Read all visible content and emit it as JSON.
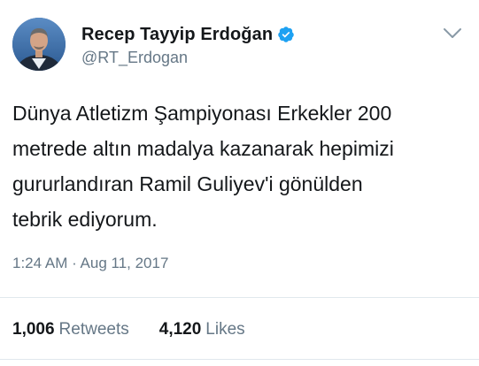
{
  "tweet": {
    "author": {
      "display_name": "Recep Tayyip Erdoğan",
      "handle": "@RT_Erdogan",
      "verified": true,
      "avatar_icon": "profile-photo"
    },
    "text": "Dünya Atletizm Şampiyonası Erkekler 200\nmetrede altın madalya kazanarak hepimizi\ngururlandıran Ramil Guliyev'i gönülden\ntebrik ediyorum.",
    "timestamp": "1:24 AM · Aug 11, 2017",
    "stats": {
      "retweets_count": "1,006",
      "retweets_label": "Retweets",
      "likes_count": "4,120",
      "likes_label": "Likes"
    },
    "menu_icon": "chevron-down-icon"
  },
  "colors": {
    "verified_blue": "#1da1f2",
    "text_primary": "#14171a",
    "text_secondary": "#657786",
    "divider": "#e1e8ed"
  }
}
